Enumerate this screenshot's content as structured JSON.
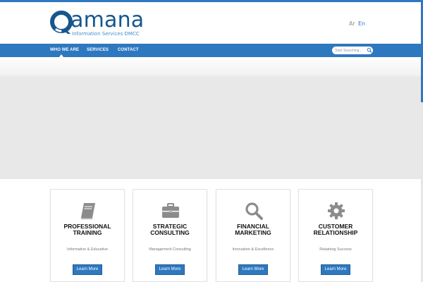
{
  "header": {
    "logo_text": "amana",
    "logo_tagline": "Information Services DMCC",
    "lang_ar": "Ar",
    "lang_en": "En"
  },
  "nav": {
    "items": [
      {
        "label": "WHO WE ARE",
        "active": true
      },
      {
        "label": "SERVICES"
      },
      {
        "label": "CONTACT"
      }
    ],
    "search_placeholder": "Start Searching..."
  },
  "colors": {
    "brand_blue": "#2e78bf",
    "logo_dark": "#16568f",
    "banner_gray": "#e8e8e8",
    "icon_gray": "#8c8c8c"
  },
  "services": [
    {
      "icon": "book-icon",
      "title_line1": "PROFESSIONAL",
      "title_line2": "TRAINING",
      "subtitle": "Informative & Educative",
      "button": "Learn More"
    },
    {
      "icon": "briefcase-icon",
      "title_line1": "STRATEGIC",
      "title_line2": "CONSULTING",
      "subtitle": "Management Consulting",
      "button": "Learn More"
    },
    {
      "icon": "magnifier-icon",
      "title_line1": "FINANCIAL",
      "title_line2": "MARKETING",
      "subtitle": "Innovation & Excellence",
      "button": "Learn More"
    },
    {
      "icon": "gear-icon",
      "title_line1": "CUSTOMER",
      "title_line2": "RELATIONSHIP",
      "subtitle": "Retaining Success",
      "button": "Learn More"
    }
  ]
}
